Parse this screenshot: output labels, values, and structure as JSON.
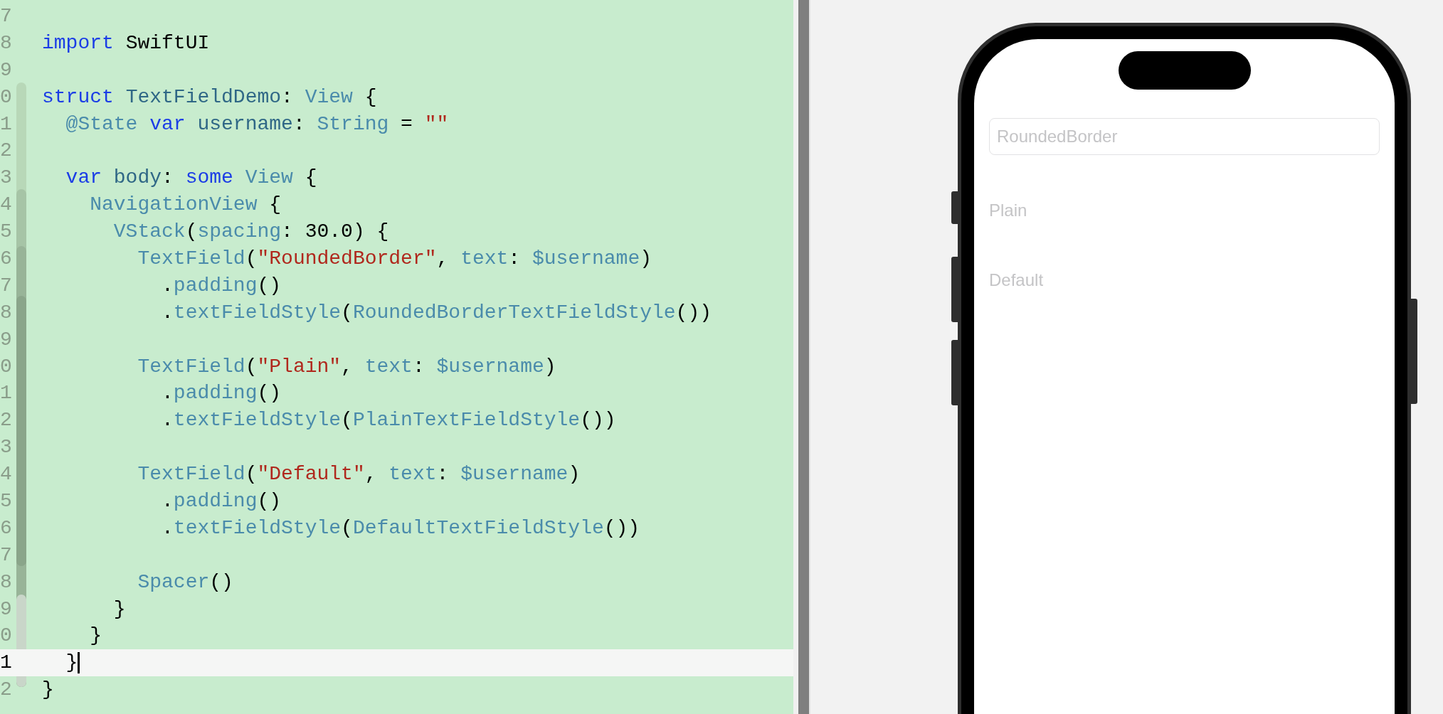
{
  "editor": {
    "lines": [
      {
        "number": "7",
        "current": false
      },
      {
        "number": "8",
        "current": false,
        "tokens": [
          {
            "kind": "keyword",
            "text": "import"
          },
          {
            "kind": "plain",
            "text": " SwiftUI"
          }
        ]
      },
      {
        "number": "9",
        "current": false
      },
      {
        "number": "0",
        "current": false,
        "tokens": [
          {
            "kind": "keyword",
            "text": "struct"
          },
          {
            "kind": "decl",
            "text": " TextFieldDemo"
          },
          {
            "kind": "plain",
            "text": ": "
          },
          {
            "kind": "type",
            "text": "View"
          },
          {
            "kind": "plain",
            "text": " {"
          }
        ]
      },
      {
        "number": "1",
        "current": false,
        "tokens": [
          {
            "kind": "type",
            "text": "  @State"
          },
          {
            "kind": "keyword",
            "text": " var"
          },
          {
            "kind": "decl",
            "text": " username"
          },
          {
            "kind": "plain",
            "text": ": "
          },
          {
            "kind": "type",
            "text": "String"
          },
          {
            "kind": "plain",
            "text": " = "
          },
          {
            "kind": "string",
            "text": "\"\""
          }
        ]
      },
      {
        "number": "2",
        "current": false
      },
      {
        "number": "3",
        "current": false,
        "tokens": [
          {
            "kind": "keyword",
            "text": "  var"
          },
          {
            "kind": "decl",
            "text": " body"
          },
          {
            "kind": "plain",
            "text": ": "
          },
          {
            "kind": "keyword",
            "text": "some"
          },
          {
            "kind": "type",
            "text": " View"
          },
          {
            "kind": "plain",
            "text": " {"
          }
        ]
      },
      {
        "number": "4",
        "current": false,
        "tokens": [
          {
            "kind": "type",
            "text": "    NavigationView"
          },
          {
            "kind": "plain",
            "text": " {"
          }
        ]
      },
      {
        "number": "5",
        "current": false,
        "tokens": [
          {
            "kind": "type",
            "text": "      VStack"
          },
          {
            "kind": "plain",
            "text": "("
          },
          {
            "kind": "type",
            "text": "spacing"
          },
          {
            "kind": "plain",
            "text": ": 30.0) {"
          }
        ]
      },
      {
        "number": "6",
        "current": false,
        "tokens": [
          {
            "kind": "type",
            "text": "        TextField"
          },
          {
            "kind": "plain",
            "text": "("
          },
          {
            "kind": "string",
            "text": "\"RoundedBorder\""
          },
          {
            "kind": "plain",
            "text": ", "
          },
          {
            "kind": "type",
            "text": "text"
          },
          {
            "kind": "plain",
            "text": ": "
          },
          {
            "kind": "type",
            "text": "$username"
          },
          {
            "kind": "plain",
            "text": ")"
          }
        ]
      },
      {
        "number": "7",
        "current": false,
        "tokens": [
          {
            "kind": "plain",
            "text": "          ."
          },
          {
            "kind": "type",
            "text": "padding"
          },
          {
            "kind": "plain",
            "text": "()"
          }
        ]
      },
      {
        "number": "8",
        "current": false,
        "tokens": [
          {
            "kind": "plain",
            "text": "          ."
          },
          {
            "kind": "type",
            "text": "textFieldStyle"
          },
          {
            "kind": "plain",
            "text": "("
          },
          {
            "kind": "type",
            "text": "RoundedBorderTextFieldStyle"
          },
          {
            "kind": "plain",
            "text": "())"
          }
        ]
      },
      {
        "number": "9",
        "current": false
      },
      {
        "number": "0",
        "current": false,
        "tokens": [
          {
            "kind": "type",
            "text": "        TextField"
          },
          {
            "kind": "plain",
            "text": "("
          },
          {
            "kind": "string",
            "text": "\"Plain\""
          },
          {
            "kind": "plain",
            "text": ", "
          },
          {
            "kind": "type",
            "text": "text"
          },
          {
            "kind": "plain",
            "text": ": "
          },
          {
            "kind": "type",
            "text": "$username"
          },
          {
            "kind": "plain",
            "text": ")"
          }
        ]
      },
      {
        "number": "1",
        "current": false,
        "tokens": [
          {
            "kind": "plain",
            "text": "          ."
          },
          {
            "kind": "type",
            "text": "padding"
          },
          {
            "kind": "plain",
            "text": "()"
          }
        ]
      },
      {
        "number": "2",
        "current": false,
        "tokens": [
          {
            "kind": "plain",
            "text": "          ."
          },
          {
            "kind": "type",
            "text": "textFieldStyle"
          },
          {
            "kind": "plain",
            "text": "("
          },
          {
            "kind": "type",
            "text": "PlainTextFieldStyle"
          },
          {
            "kind": "plain",
            "text": "())"
          }
        ]
      },
      {
        "number": "3",
        "current": false
      },
      {
        "number": "4",
        "current": false,
        "tokens": [
          {
            "kind": "type",
            "text": "        TextField"
          },
          {
            "kind": "plain",
            "text": "("
          },
          {
            "kind": "string",
            "text": "\"Default\""
          },
          {
            "kind": "plain",
            "text": ", "
          },
          {
            "kind": "type",
            "text": "text"
          },
          {
            "kind": "plain",
            "text": ": "
          },
          {
            "kind": "type",
            "text": "$username"
          },
          {
            "kind": "plain",
            "text": ")"
          }
        ]
      },
      {
        "number": "5",
        "current": false,
        "tokens": [
          {
            "kind": "plain",
            "text": "          ."
          },
          {
            "kind": "type",
            "text": "padding"
          },
          {
            "kind": "plain",
            "text": "()"
          }
        ]
      },
      {
        "number": "6",
        "current": false,
        "tokens": [
          {
            "kind": "plain",
            "text": "          ."
          },
          {
            "kind": "type",
            "text": "textFieldStyle"
          },
          {
            "kind": "plain",
            "text": "("
          },
          {
            "kind": "type",
            "text": "DefaultTextFieldStyle"
          },
          {
            "kind": "plain",
            "text": "())"
          }
        ]
      },
      {
        "number": "7",
        "current": false
      },
      {
        "number": "8",
        "current": false,
        "tokens": [
          {
            "kind": "type",
            "text": "        Spacer"
          },
          {
            "kind": "plain",
            "text": "()"
          }
        ]
      },
      {
        "number": "9",
        "current": false,
        "tokens": [
          {
            "kind": "plain",
            "text": "      }"
          }
        ]
      },
      {
        "number": "0",
        "current": false,
        "tokens": [
          {
            "kind": "plain",
            "text": "    }"
          }
        ]
      },
      {
        "number": "1",
        "current": true,
        "tokens": [
          {
            "kind": "plain",
            "text": "  }"
          }
        ]
      },
      {
        "number": "2",
        "current": false,
        "tokens": [
          {
            "kind": "plain",
            "text": "}"
          }
        ]
      }
    ]
  },
  "simulator": {
    "fields": [
      {
        "kind": "rounded",
        "placeholder": "RoundedBorder"
      },
      {
        "kind": "plain",
        "placeholder": "Plain"
      },
      {
        "kind": "plain",
        "placeholder": "Default"
      }
    ]
  }
}
